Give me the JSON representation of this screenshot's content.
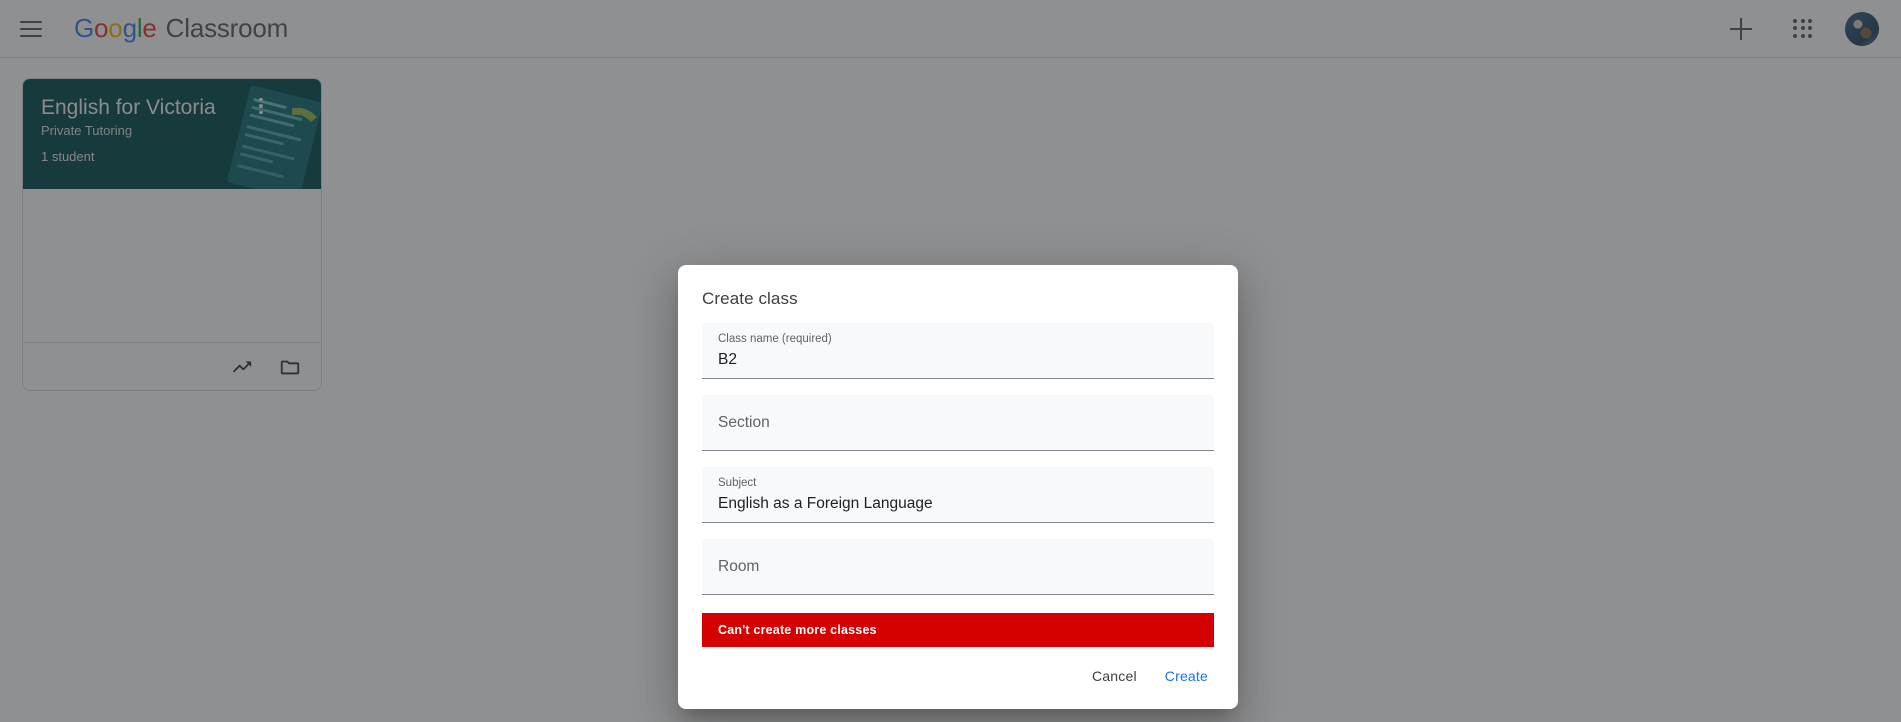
{
  "header": {
    "menu_icon": "hamburger-menu-icon",
    "brand_google": [
      "G",
      "o",
      "o",
      "g",
      "l",
      "e"
    ],
    "brand_product": "Classroom",
    "add_icon": "plus-icon",
    "apps_icon": "apps-grid-icon",
    "avatar_icon": "user-avatar"
  },
  "cards": [
    {
      "title": "English for Victoria",
      "section": "Private Tutoring",
      "students": "1 student",
      "header_color": "#0f5257",
      "menu_icon": "more-vert-icon",
      "footer_icons": [
        "trending-up-icon",
        "folder-icon"
      ]
    }
  ],
  "dialog": {
    "title": "Create class",
    "fields": [
      {
        "label": "Class name (required)",
        "value": "B2",
        "placeholder": "",
        "filled": true
      },
      {
        "label": "Section",
        "value": "",
        "placeholder": "Section",
        "filled": false
      },
      {
        "label": "Subject",
        "value": "English as a Foreign Language",
        "placeholder": "",
        "filled": true
      },
      {
        "label": "Room",
        "value": "",
        "placeholder": "Room",
        "filled": false
      }
    ],
    "error": {
      "message": "Can't create more classes",
      "color": "#d50000"
    },
    "cancel_label": "Cancel",
    "create_label": "Create",
    "create_color": "#1a73e8"
  }
}
